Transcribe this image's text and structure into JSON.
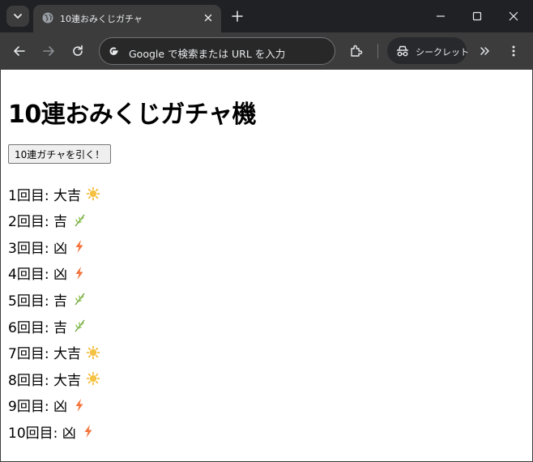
{
  "browser": {
    "tab_title": "10連おみくじガチャ",
    "omnibox_placeholder": "Google で検索または URL を入力",
    "incognito_label": "シークレット"
  },
  "page": {
    "title": "10連おみくじガチャ機",
    "draw_button_label": "10連ガチャを引く！",
    "results": [
      {
        "label": "1回目: 大吉",
        "icon": "sun-icon"
      },
      {
        "label": "2回目: 吉",
        "icon": "herb-icon"
      },
      {
        "label": "3回目: 凶",
        "icon": "lightning-icon"
      },
      {
        "label": "4回目: 凶",
        "icon": "lightning-icon"
      },
      {
        "label": "5回目: 吉",
        "icon": "herb-icon"
      },
      {
        "label": "6回目: 吉",
        "icon": "herb-icon"
      },
      {
        "label": "7回目: 大吉",
        "icon": "sun-icon"
      },
      {
        "label": "8回目: 大吉",
        "icon": "sun-icon"
      },
      {
        "label": "9回目: 凶",
        "icon": "lightning-icon"
      },
      {
        "label": "10回目: 凶",
        "icon": "lightning-icon"
      }
    ]
  },
  "colors": {
    "chrome_dark": "#202124",
    "chrome_toolbar": "#3c3c3c",
    "sun": "#f3b323",
    "herb": "#7cb342",
    "lightning": "#f4733c"
  }
}
